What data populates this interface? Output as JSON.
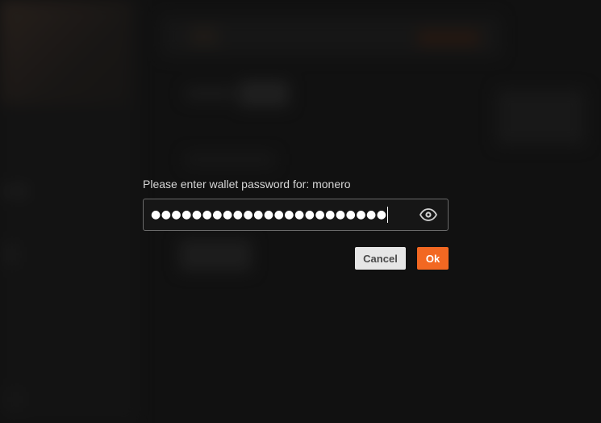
{
  "dialog": {
    "prompt": "Please enter wallet password for: monero",
    "password_masked": "●●●●●●●●●●●●●●●●●●●●●●●",
    "show_password_icon": "eye-icon",
    "cancel_label": "Cancel",
    "ok_label": "Ok"
  },
  "colors": {
    "accent": "#f26822",
    "cancel_bg": "#e6e6e6",
    "input_border": "#6a6a6a",
    "text": "#d6d6d6"
  }
}
